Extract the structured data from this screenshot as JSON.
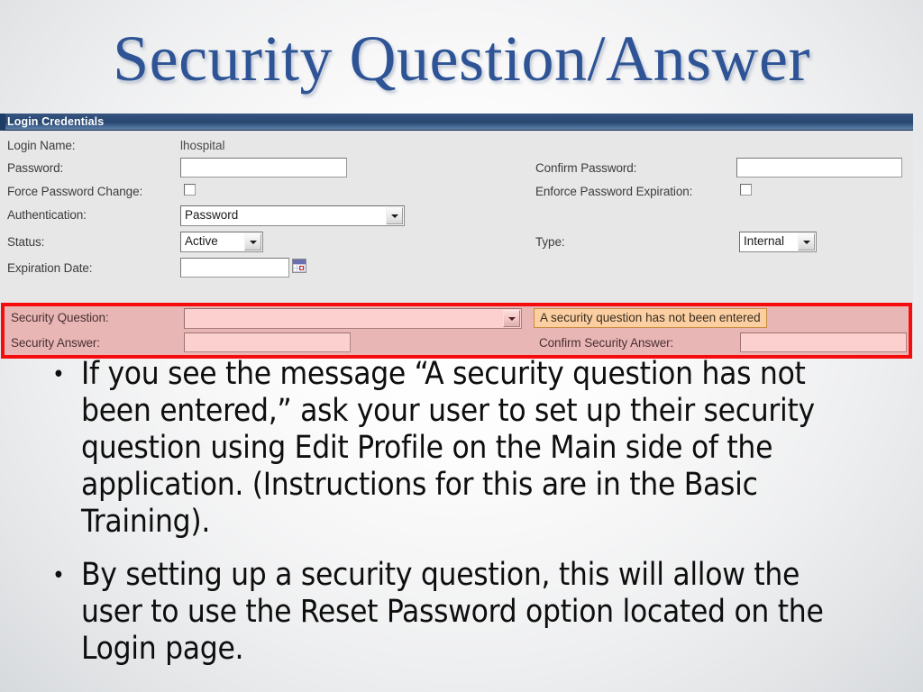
{
  "slide": {
    "title": "Security Question/Answer",
    "title_color": "#2e5496"
  },
  "form": {
    "panel_title": "Login Credentials",
    "fields": {
      "login_name_label": "Login Name:",
      "login_name_value": "lhospital",
      "password_label": "Password:",
      "password_value": "",
      "confirm_password_label": "Confirm Password:",
      "confirm_password_value": "",
      "force_password_change_label": "Force Password Change:",
      "force_password_change_checked": false,
      "enforce_password_expiration_label": "Enforce Password Expiration:",
      "enforce_password_expiration_checked": false,
      "authentication_label": "Authentication:",
      "authentication_value": "Password",
      "status_label": "Status:",
      "status_value": "Active",
      "type_label": "Type:",
      "type_value": "Internal",
      "expiration_date_label": "Expiration Date:",
      "expiration_date_value": "",
      "security_question_label": "Security Question:",
      "security_question_value": "",
      "security_answer_label": "Security Answer:",
      "security_answer_value": "",
      "confirm_security_answer_label": "Confirm Security Answer:",
      "confirm_security_answer_value": ""
    },
    "warning_message": "A security question has not been entered",
    "highlight_color": "#f50d0d",
    "warning_bg_color": "#fbcfa2",
    "highlight_bg_color": "#e9b6b6"
  },
  "bullets": [
    {
      "marker": "•",
      "text": "If you see the message “A security question has not been entered,” ask your user to set up their security question using Edit Profile on the Main side of the application. (Instructions for this are in the Basic Training)."
    },
    {
      "marker": "•",
      "text": "By setting up a security question, this will allow the user to use the Reset Password option located on the Login page."
    }
  ]
}
